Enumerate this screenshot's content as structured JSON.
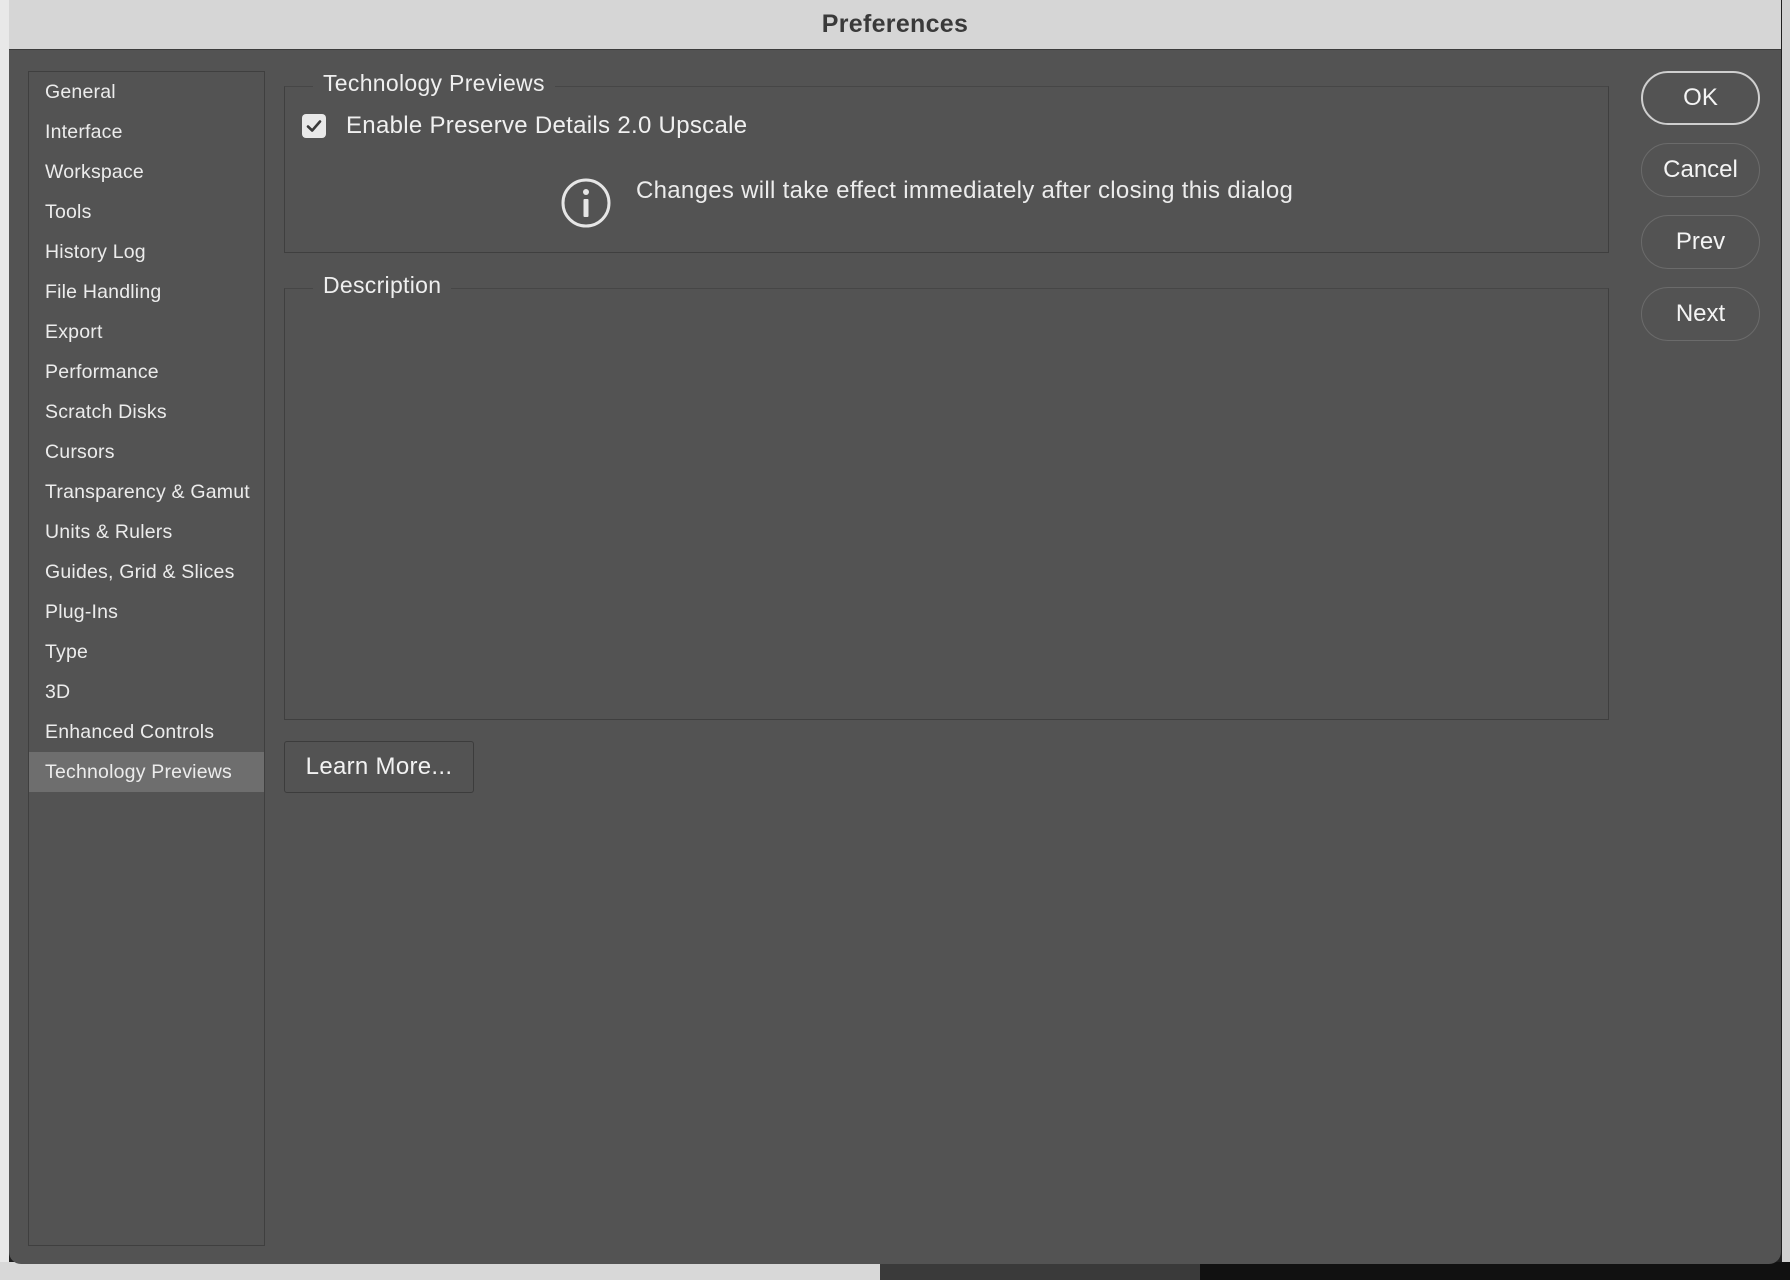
{
  "window": {
    "title": "Preferences"
  },
  "sidebar": {
    "items": [
      {
        "label": "General"
      },
      {
        "label": "Interface"
      },
      {
        "label": "Workspace"
      },
      {
        "label": "Tools"
      },
      {
        "label": "History Log"
      },
      {
        "label": "File Handling"
      },
      {
        "label": "Export"
      },
      {
        "label": "Performance"
      },
      {
        "label": "Scratch Disks"
      },
      {
        "label": "Cursors"
      },
      {
        "label": "Transparency & Gamut"
      },
      {
        "label": "Units & Rulers"
      },
      {
        "label": "Guides, Grid & Slices"
      },
      {
        "label": "Plug-Ins"
      },
      {
        "label": "Type"
      },
      {
        "label": "3D"
      },
      {
        "label": "Enhanced Controls"
      },
      {
        "label": "Technology Previews",
        "selected": true
      }
    ]
  },
  "technology_previews": {
    "legend": "Technology Previews",
    "checkbox": {
      "label": "Enable Preserve Details 2.0 Upscale",
      "checked": true
    },
    "info": {
      "icon": "info-icon",
      "text": "Changes will take effect immediately after closing this dialog"
    }
  },
  "description": {
    "legend": "Description",
    "text": ""
  },
  "learn_more": {
    "label": "Learn More..."
  },
  "buttons": {
    "ok": "OK",
    "cancel": "Cancel",
    "prev": "Prev",
    "next": "Next"
  },
  "colors": {
    "dialog_bg": "#535353",
    "titlebar_bg": "#d6d6d6",
    "selected_item_bg": "#6e6e6e",
    "text": "#ececec"
  }
}
